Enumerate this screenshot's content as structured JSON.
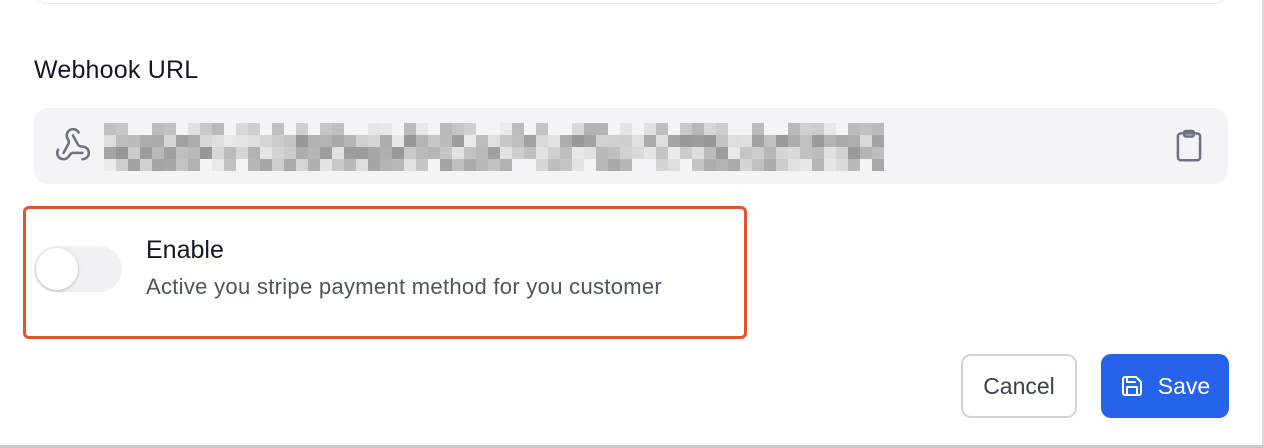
{
  "webhook": {
    "label": "Webhook URL",
    "icon": "webhook-icon",
    "value_redacted": true
  },
  "copy_icon": "clipboard-icon",
  "toggle": {
    "title": "Enable",
    "description": "Active you stripe payment method for you customer",
    "enabled": false
  },
  "actions": {
    "cancel_label": "Cancel",
    "save_label": "Save",
    "save_icon": "save-icon"
  },
  "colors": {
    "primary": "#2563eb",
    "highlight": "#e5522f",
    "field_bg": "#f3f4f6"
  }
}
